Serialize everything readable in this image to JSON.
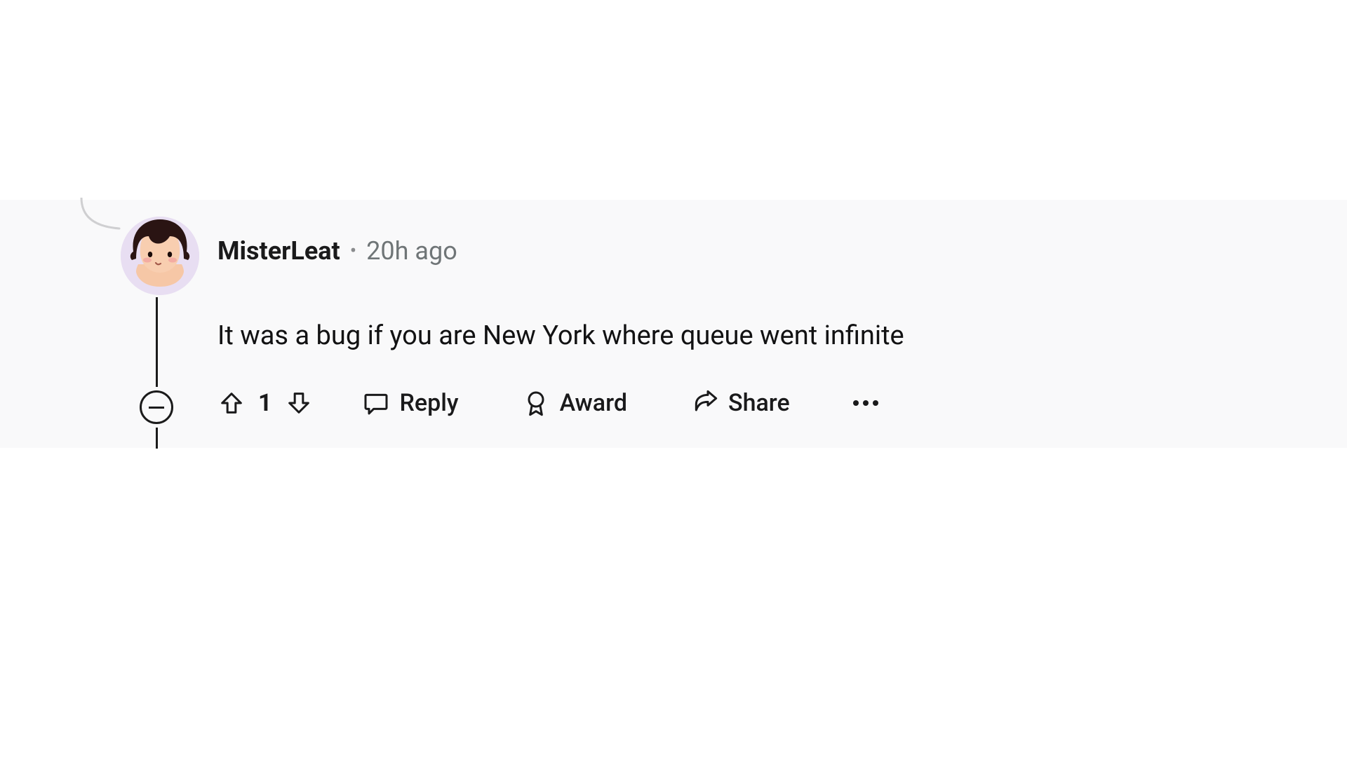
{
  "comment": {
    "username": "MisterLeat",
    "separator": "•",
    "timestamp": "20h ago",
    "body": "It was a bug if you are New York where queue went infinite",
    "score": "1",
    "actions": {
      "reply": "Reply",
      "award": "Award",
      "share": "Share"
    }
  }
}
